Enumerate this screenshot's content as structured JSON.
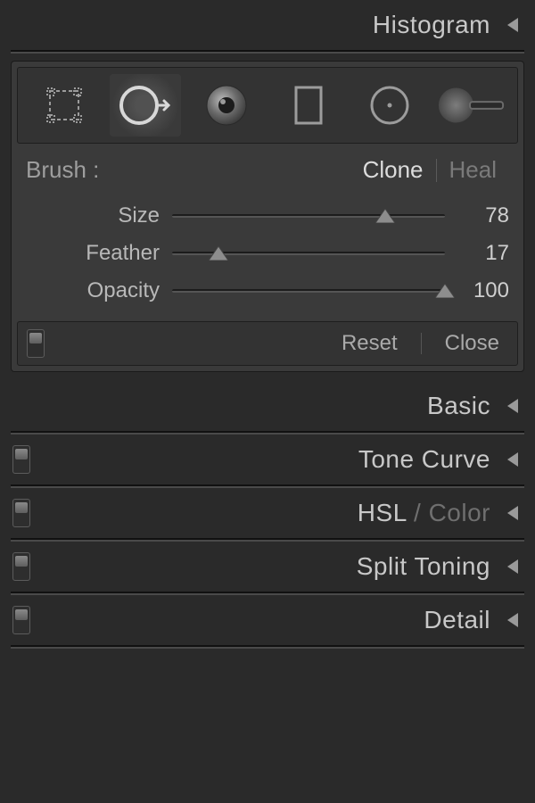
{
  "sections": {
    "histogram": {
      "title": "Histogram"
    },
    "basic": {
      "title": "Basic"
    },
    "toneCurve": {
      "title": "Tone Curve"
    },
    "hslColor": {
      "title_a": "HSL",
      "title_sep": " / ",
      "title_b": "Color"
    },
    "splitToning": {
      "title": "Split Toning"
    },
    "detail": {
      "title": "Detail"
    }
  },
  "brush": {
    "label": "Brush :",
    "modeClone": "Clone",
    "modeHeal": "Heal",
    "sliders": {
      "size": {
        "label": "Size",
        "value": "78",
        "percent": 78
      },
      "feather": {
        "label": "Feather",
        "value": "17",
        "percent": 17
      },
      "opacity": {
        "label": "Opacity",
        "value": "100",
        "percent": 100
      }
    },
    "footer": {
      "reset": "Reset",
      "close": "Close"
    }
  }
}
